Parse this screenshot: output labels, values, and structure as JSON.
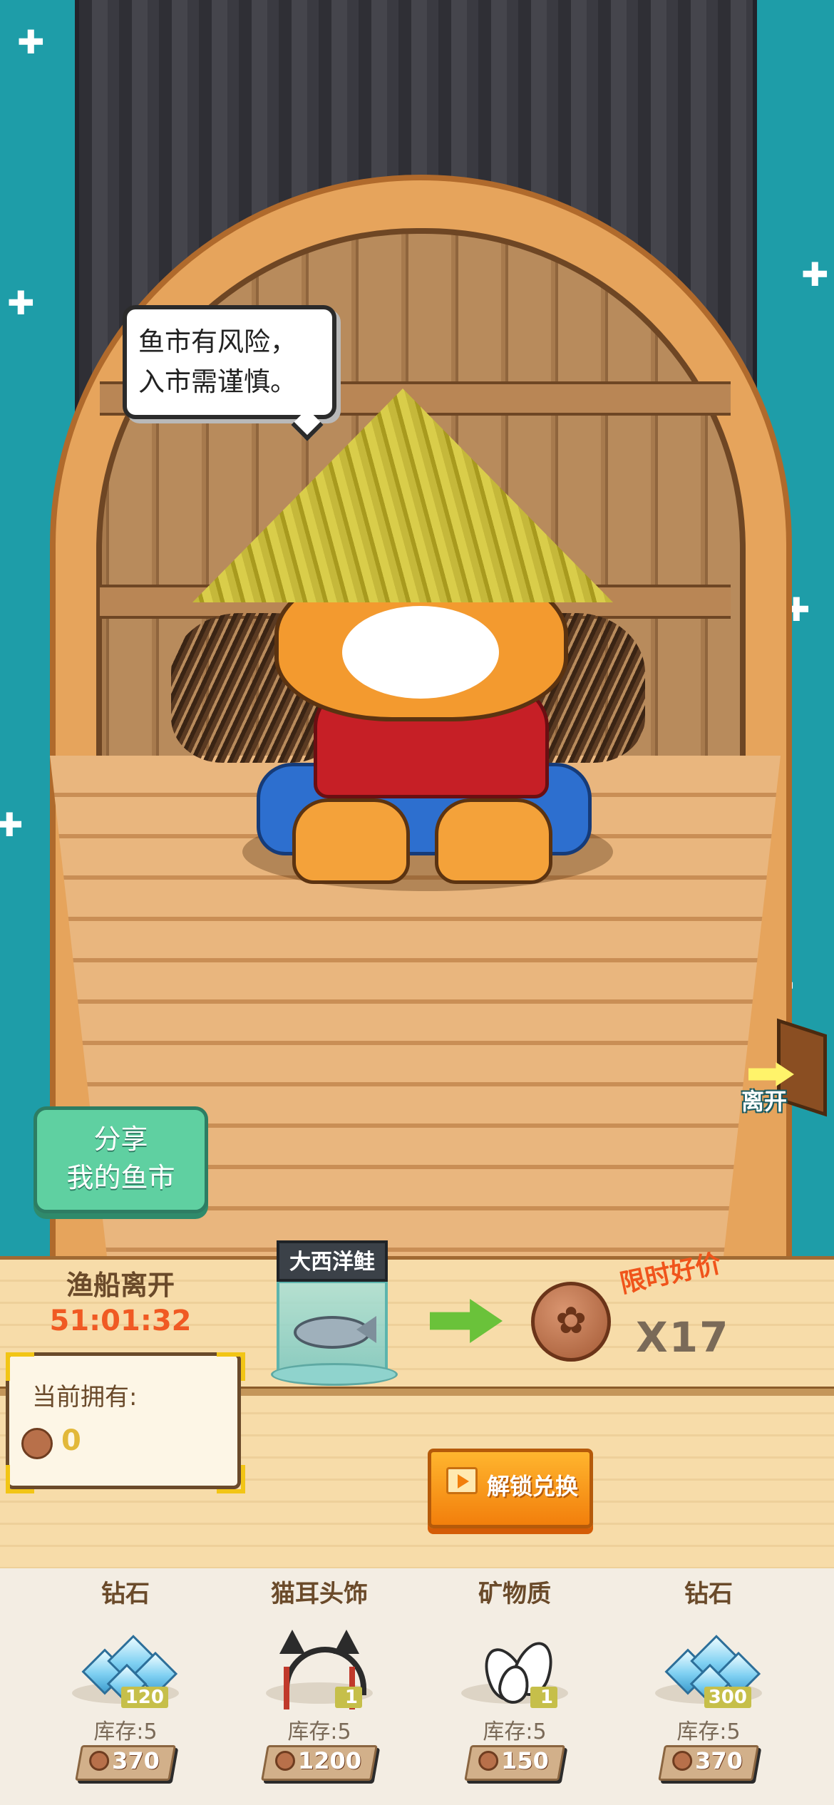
{
  "speech_bubble": {
    "line1": "鱼市有风险，",
    "line2": "入市需谨慎。"
  },
  "share_button": {
    "line1": "分享",
    "line2": "我的鱼市"
  },
  "leave_button": {
    "label": "离开",
    "icon": "door-exit-icon"
  },
  "boat_status": {
    "title": "渔船离开",
    "countdown": "51:01:32"
  },
  "owned": {
    "label": "当前拥有:",
    "value": "0",
    "icon": "fish-coin-icon"
  },
  "trade": {
    "fish_name": "大西洋鲑",
    "fish_icon": "salmon-icon",
    "arrow_icon": "green-arrow-right-icon",
    "coin_icon": "fish-coin-icon",
    "deal_label": "限时好价",
    "reward_count": "X17",
    "unlock_label": "解锁兑换",
    "unlock_icon": "video-play-icon"
  },
  "store_items": [
    {
      "name": "钻石",
      "icon": "diamond-icon",
      "quantity": "120",
      "stock": "库存:5",
      "price": "370"
    },
    {
      "name": "猫耳头饰",
      "icon": "cat-ear-headband-icon",
      "quantity": "1",
      "stock": "库存:5",
      "price": "1200"
    },
    {
      "name": "矿物质",
      "icon": "mineral-seeds-icon",
      "quantity": "1",
      "stock": "库存:5",
      "price": "150"
    },
    {
      "name": "钻石",
      "icon": "diamond-icon",
      "quantity": "300",
      "stock": "库存:5",
      "price": "370"
    }
  ],
  "colors": {
    "sea": "#1e9da8",
    "countdown": "#f05a23",
    "deal_label": "#f0541b",
    "share_button": "#5fd0a1",
    "unlock_button": "#f27f0c"
  }
}
